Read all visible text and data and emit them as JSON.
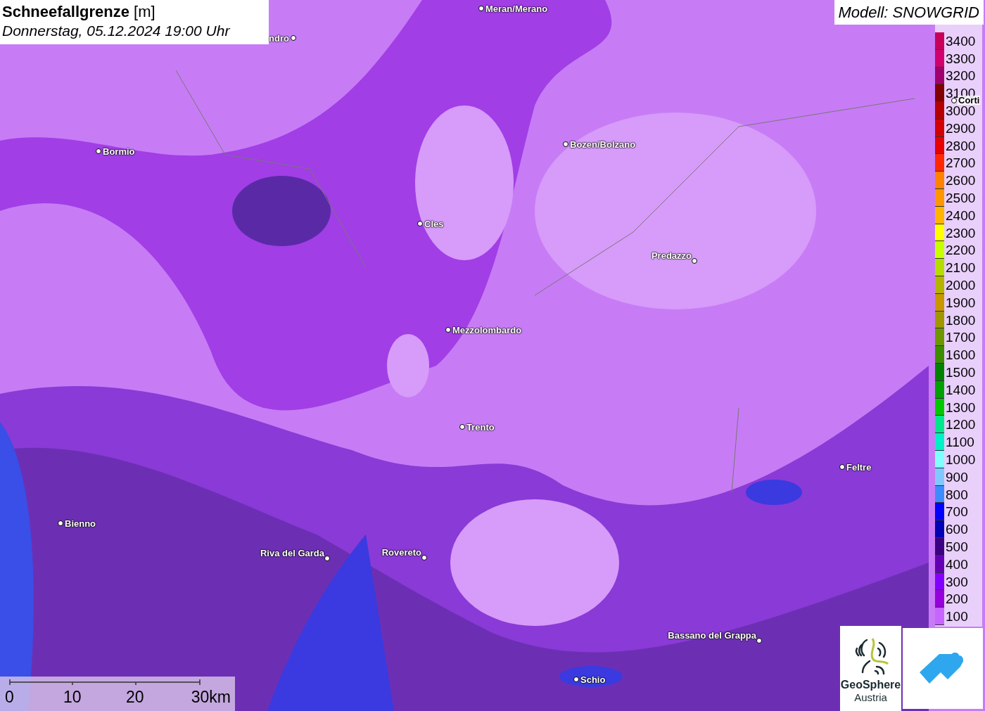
{
  "title": {
    "name": "Schneefallgrenze",
    "unit": "[m]",
    "datetime": "Donnerstag, 05.12.2024 19:00 Uhr"
  },
  "model_label": "Modell: SNOWGRID",
  "places": [
    {
      "name": "Meran/Merano"
    },
    {
      "name": "ndro"
    },
    {
      "name": "Bormio"
    },
    {
      "name": "Bozen/Bolzano"
    },
    {
      "name": "Cles"
    },
    {
      "name": "Predazzo"
    },
    {
      "name": "Mezzolombardo"
    },
    {
      "name": "Trento"
    },
    {
      "name": "Feltre"
    },
    {
      "name": "Bienno"
    },
    {
      "name": "Riva del Garda"
    },
    {
      "name": "Rovereto"
    },
    {
      "name": "Bassano del Grappa"
    },
    {
      "name": "Schio"
    },
    {
      "name": "Corti"
    }
  ],
  "legend": [
    {
      "label": "3400",
      "color": "#c8005a"
    },
    {
      "label": "3300",
      "color": "#d2006e"
    },
    {
      "label": "3200",
      "color": "#a0006e"
    },
    {
      "label": "3100",
      "color": "#820000"
    },
    {
      "label": "3000",
      "color": "#b40000"
    },
    {
      "label": "2900",
      "color": "#d20000"
    },
    {
      "label": "2800",
      "color": "#e60000"
    },
    {
      "label": "2700",
      "color": "#ff2800"
    },
    {
      "label": "2600",
      "color": "#ff8200"
    },
    {
      "label": "2500",
      "color": "#ff9600"
    },
    {
      "label": "2400",
      "color": "#ffb400"
    },
    {
      "label": "2300",
      "color": "#ffff00"
    },
    {
      "label": "2200",
      "color": "#c8ff00"
    },
    {
      "label": "2100",
      "color": "#b4dc00"
    },
    {
      "label": "2000",
      "color": "#b4b400"
    },
    {
      "label": "1900",
      "color": "#c89600"
    },
    {
      "label": "1800",
      "color": "#a09600"
    },
    {
      "label": "1700",
      "color": "#6e9600"
    },
    {
      "label": "1600",
      "color": "#3c8c00"
    },
    {
      "label": "1500",
      "color": "#008200"
    },
    {
      "label": "1400",
      "color": "#00a000"
    },
    {
      "label": "1300",
      "color": "#00c800"
    },
    {
      "label": "1200",
      "color": "#00e68c"
    },
    {
      "label": "1100",
      "color": "#00f0c8"
    },
    {
      "label": "1000",
      "color": "#80ffff"
    },
    {
      "label": "900",
      "color": "#80c8ff"
    },
    {
      "label": "800",
      "color": "#3c8cff"
    },
    {
      "label": "700",
      "color": "#0000ff"
    },
    {
      "label": "600",
      "color": "#0000b4"
    },
    {
      "label": "500",
      "color": "#3c0082"
    },
    {
      "label": "400",
      "color": "#6400b4"
    },
    {
      "label": "300",
      "color": "#8200ff"
    },
    {
      "label": "200",
      "color": "#9600dc"
    },
    {
      "label": "100",
      "color": "#c864ff"
    }
  ],
  "scale_bar": {
    "ticks": [
      "0",
      "10",
      "20",
      "30km"
    ]
  },
  "logos": {
    "brand_line_1": "GeoSphere",
    "brand_line_2": "Austria"
  }
}
